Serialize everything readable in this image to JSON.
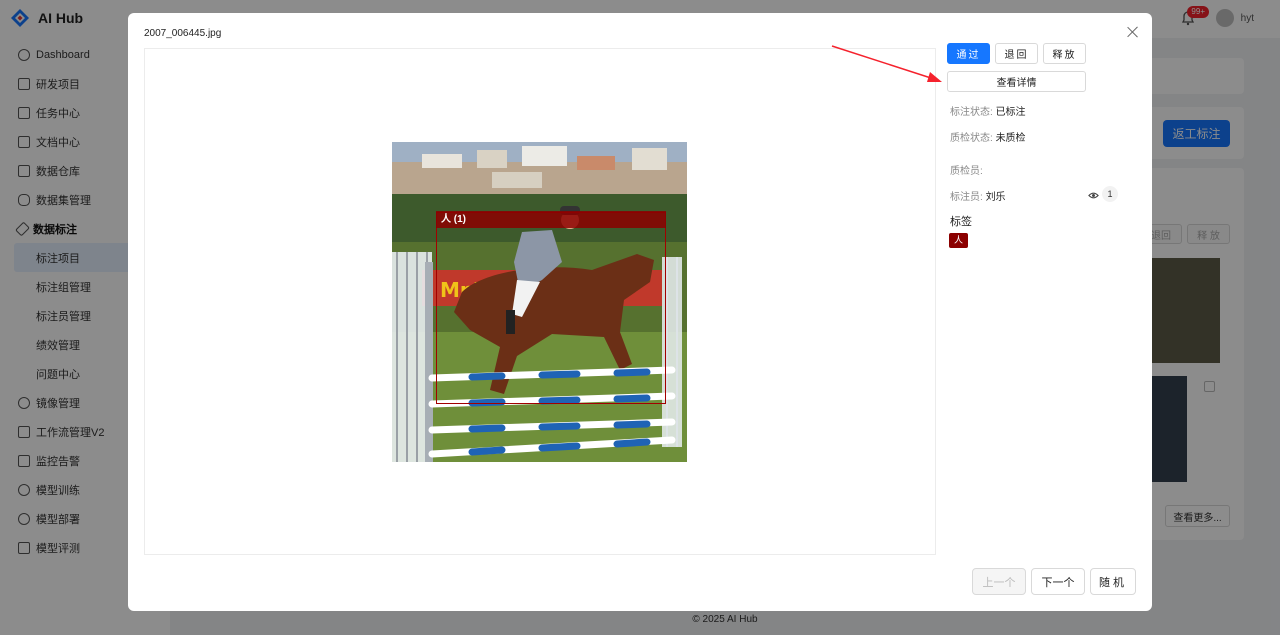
{
  "app": {
    "name": "AI Hub",
    "brand_color": "#1677ff",
    "logo_icon": "diamond-logo"
  },
  "sidebar": {
    "items": [
      {
        "label": "Dashboard",
        "icon": "dashboard-icon"
      },
      {
        "label": "研发项目",
        "icon": "folder-icon"
      },
      {
        "label": "任务中心",
        "icon": "task-icon"
      },
      {
        "label": "文档中心",
        "icon": "doc-icon"
      },
      {
        "label": "数据仓库",
        "icon": "home-icon"
      },
      {
        "label": "数据集管理",
        "icon": "database-icon"
      },
      {
        "label": "数据标注",
        "icon": "pen-icon"
      }
    ],
    "subitems": [
      {
        "label": "标注项目"
      },
      {
        "label": "标注组管理"
      },
      {
        "label": "标注员管理"
      },
      {
        "label": "绩效管理"
      },
      {
        "label": "问题中心"
      }
    ],
    "items_after": [
      {
        "label": "镜像管理",
        "icon": "image-icon"
      },
      {
        "label": "工作流管理V2",
        "icon": "workflow-icon"
      },
      {
        "label": "监控告警",
        "icon": "warning-icon"
      },
      {
        "label": "模型训练",
        "icon": "train-icon"
      },
      {
        "label": "模型部署",
        "icon": "deploy-icon"
      },
      {
        "label": "模型评测",
        "icon": "eval-icon"
      }
    ]
  },
  "topbar": {
    "badge": "99+",
    "user": "hyt"
  },
  "background": {
    "rework_button": "返工标注",
    "back_button": "退回",
    "release_button": "释 放",
    "more_button": "查看更多..."
  },
  "footer": "© 2025 AI Hub",
  "modal": {
    "title": "2007_006445.jpg",
    "buttons": {
      "pass": "通过",
      "return": "退回",
      "release": "释放",
      "details": "查看详情"
    },
    "info": {
      "annotation_status_key": "标注状态:",
      "annotation_status_value": "已标注",
      "qc_status_key": "质检状态:",
      "qc_status_value": "未质检",
      "qc_person_key": "质检员:",
      "annotator_key": "标注员:",
      "annotator_value": "刘乐",
      "view_count": "1",
      "tags_heading": "标签",
      "tag": "人"
    },
    "bbox_label": "人 (1)",
    "bbox_color": "#a30000",
    "pager": {
      "prev": "上一个",
      "next": "下一个",
      "random": "随机"
    }
  }
}
